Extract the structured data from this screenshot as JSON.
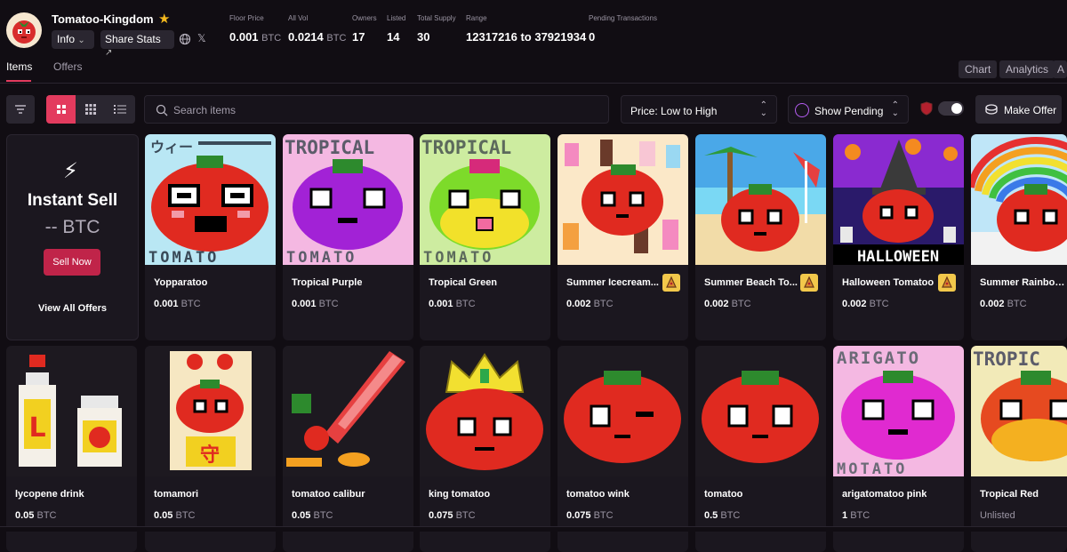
{
  "collection": {
    "name": "Tomatoo-Kingdom"
  },
  "header_buttons": {
    "info": "Info",
    "share": "Share Stats"
  },
  "stats": [
    {
      "label": "Floor Price",
      "value": "0.001",
      "unit": "BTC"
    },
    {
      "label": "All Vol",
      "value": "0.0214",
      "unit": "BTC"
    },
    {
      "label": "Owners",
      "value": "17",
      "unit": ""
    },
    {
      "label": "Listed",
      "value": "14",
      "unit": ""
    },
    {
      "label": "Total Supply",
      "value": "30",
      "unit": ""
    },
    {
      "label": "Range",
      "value": "12317216 to 37921934",
      "unit": ""
    },
    {
      "label": "Pending Transactions",
      "value": "0",
      "unit": ""
    }
  ],
  "tabs": {
    "items": "Items",
    "offers": "Offers"
  },
  "right_pills": {
    "chart": "Chart",
    "analytics": "Analytics",
    "third": "A"
  },
  "toolbar": {
    "search_placeholder": "Search items",
    "sort_value": "Price: Low to High",
    "show_pending": "Show Pending",
    "make_offer": "Make Offer"
  },
  "instant_sell": {
    "title": "Instant Sell",
    "price": "-- BTC",
    "sell_button": "Sell Now",
    "view_all": "View All Offers"
  },
  "cards": [
    {
      "name": "Yopparatoo",
      "price": "0.001",
      "unit": "BTC",
      "badge": false
    },
    {
      "name": "Tropical Purple",
      "price": "0.001",
      "unit": "BTC",
      "badge": false
    },
    {
      "name": "Tropical Green",
      "price": "0.001",
      "unit": "BTC",
      "badge": false
    },
    {
      "name": "Summer Icecream...",
      "price": "0.002",
      "unit": "BTC",
      "badge": true
    },
    {
      "name": "Summer Beach To...",
      "price": "0.002",
      "unit": "BTC",
      "badge": true
    },
    {
      "name": "Halloween Tomatoo",
      "price": "0.002",
      "unit": "BTC",
      "badge": true
    },
    {
      "name": "Summer Rainbow ...",
      "price": "0.002",
      "unit": "BTC",
      "badge": false
    },
    {
      "name": "lycopene drink",
      "price": "0.05",
      "unit": "BTC",
      "badge": false
    },
    {
      "name": "tomamori",
      "price": "0.05",
      "unit": "BTC",
      "badge": false
    },
    {
      "name": "tomatoo calibur",
      "price": "0.05",
      "unit": "BTC",
      "badge": false
    },
    {
      "name": "king tomatoo",
      "price": "0.075",
      "unit": "BTC",
      "badge": false
    },
    {
      "name": "tomatoo wink",
      "price": "0.075",
      "unit": "BTC",
      "badge": false
    },
    {
      "name": "tomatoo",
      "price": "0.5",
      "unit": "BTC",
      "badge": false
    },
    {
      "name": "arigatomatoo pink",
      "price": "1",
      "unit": "BTC",
      "badge": false
    },
    {
      "name": "Tropical Red",
      "price": "Unlisted",
      "unit": "",
      "badge": false
    }
  ],
  "art_labels": {
    "tropical": "TROPICAL",
    "tomato": "TOMATO",
    "halloween": "HALLOWEEN",
    "arigato": "ARIGATO",
    "tropic": "TROPIC",
    "motato": "MOTATO",
    "kanji": "守",
    "yopparatoo_header": "ウィー"
  },
  "colors": {
    "accent": "#e33b5e",
    "sell_button": "#c02449",
    "star": "#f5b91e",
    "badge": "#f2c84b"
  }
}
